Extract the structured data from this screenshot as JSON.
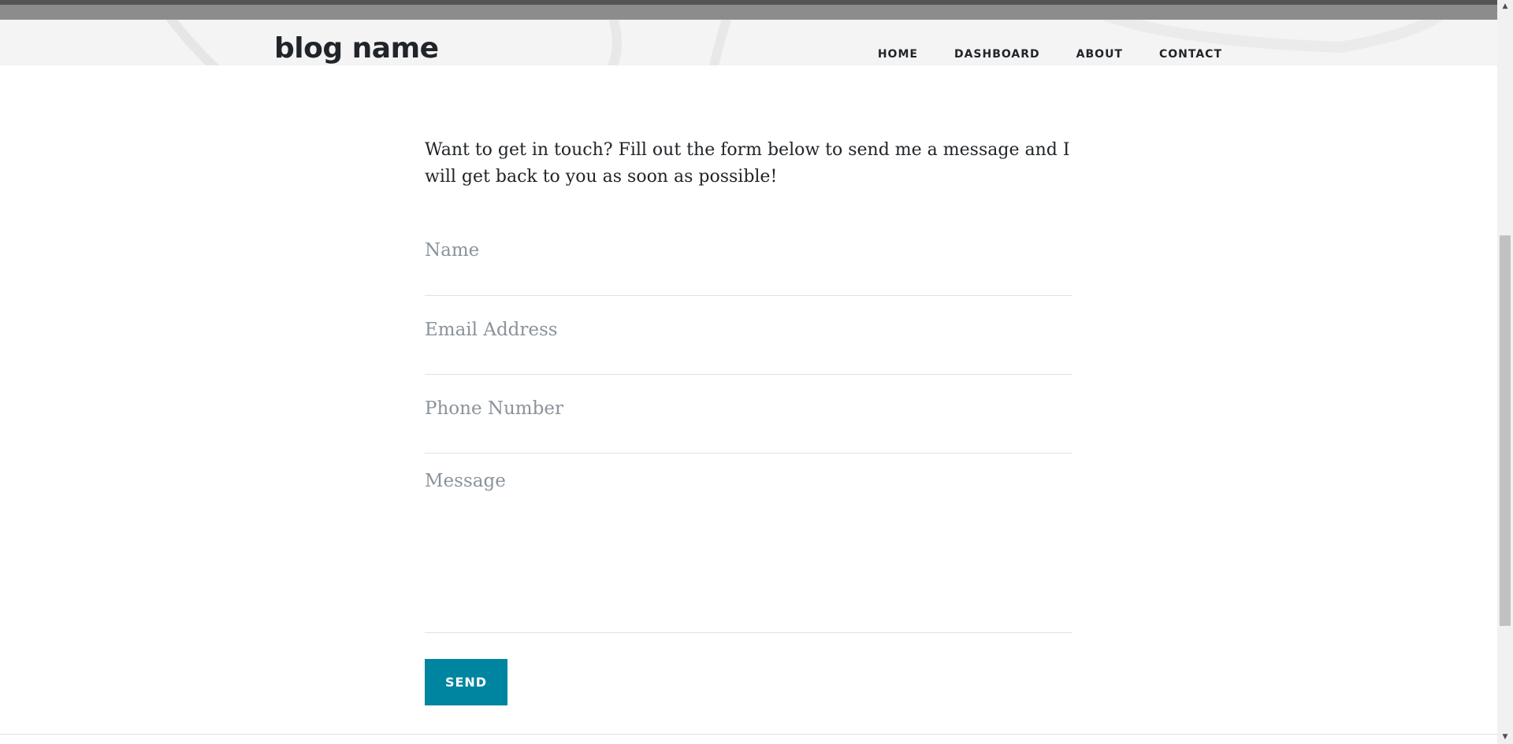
{
  "navbar": {
    "brand": "blog name",
    "links": [
      "HOME",
      "DASHBOARD",
      "ABOUT",
      "CONTACT"
    ]
  },
  "content": {
    "intro": "Want to get in touch? Fill out the form below to send me a message and I will get back to you as soon as possible!"
  },
  "form": {
    "name_placeholder": "Name",
    "email_placeholder": "Email Address",
    "phone_placeholder": "Phone Number",
    "message_placeholder": "Message",
    "send_label": "SEND"
  },
  "scrollbar": {
    "up_icon": "triangle-up-icon",
    "down_icon": "triangle-down-icon"
  },
  "colors": {
    "accent": "#0085a1",
    "text": "#212529",
    "placeholder": "#8a939b"
  }
}
